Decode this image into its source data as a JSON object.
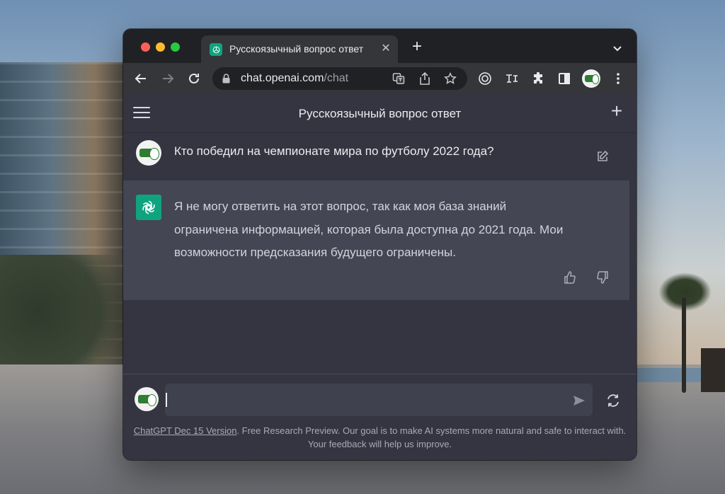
{
  "browser": {
    "tab_title": "Русскоязычный вопрос ответ",
    "tab_close": "✕",
    "new_tab": "+",
    "url_host": "chat.openai.com",
    "url_path": "/chat"
  },
  "app": {
    "title": "Русскоязычный вопрос ответ",
    "new_chat": "+"
  },
  "conversation": {
    "user_message": "Кто победил на чемпионате мира по футболу 2022 года?",
    "assistant_message": "Я не могу ответить на этот вопрос, так как моя база знаний ограничена информацией, которая была доступна до 2021 года. Мои возможности предсказания будущего ограничены."
  },
  "composer": {
    "value": "",
    "placeholder": ""
  },
  "footer": {
    "version_link": "ChatGPT Dec 15 Version",
    "note": ". Free Research Preview. Our goal is to make AI systems more natural and safe to interact with. Your feedback will help us improve."
  },
  "colors": {
    "accent": "#10a37f",
    "app_background": "#343541",
    "assistant_row": "#444654",
    "composer": "#40414f"
  },
  "icons": {
    "back": "arrow-left-icon",
    "forward": "arrow-right-icon",
    "reload": "reload-icon",
    "lock": "lock-icon",
    "translate": "translate-icon",
    "share": "share-icon",
    "bookmark": "star-icon",
    "extensions": "puzzle-icon",
    "menu": "kebab-icon",
    "edit": "edit-icon",
    "like": "thumb-up-icon",
    "dislike": "thumb-down-icon",
    "send": "send-icon",
    "regenerate": "refresh-icon"
  }
}
